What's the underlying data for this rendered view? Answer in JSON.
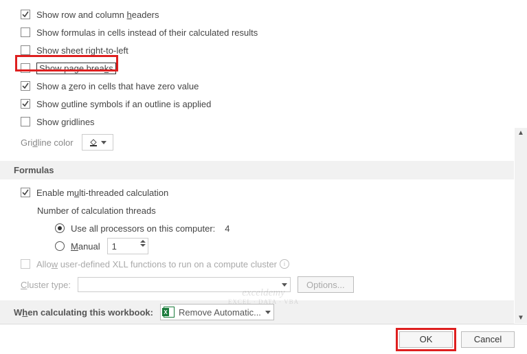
{
  "options": {
    "show_headers": "Show row and column headers",
    "show_formulas": "Show formulas in cells instead of their calculated results",
    "show_sheet_rtl": "Show sheet right-to-left",
    "show_page_breaks": "Show page breaks",
    "show_zero": "Show a zero in cells that have zero value",
    "show_outline": "Show outline symbols if an outline is applied",
    "show_gridlines": "Show gridlines",
    "gridline_color_label": "Gridline color"
  },
  "formulas": {
    "section_title": "Formulas",
    "multithread": "Enable multi-threaded calculation",
    "threads_label": "Number of calculation threads",
    "use_all_label": "Use all processors on this computer:",
    "processor_count": "4",
    "manual_label": "Manual",
    "manual_value": "1",
    "allow_xll": "Allow user-defined XLL functions to run on a compute cluster",
    "cluster_type_label": "Cluster type:",
    "options_btn": "Options..."
  },
  "workbook": {
    "when_calc_label": "When calculating this workbook:",
    "dropdown_value": "Remove Automatic..."
  },
  "footer": {
    "ok": "OK",
    "cancel": "Cancel"
  },
  "watermark": {
    "main": "exceldemy",
    "sub": "EXCEL · DATA · VBA"
  }
}
